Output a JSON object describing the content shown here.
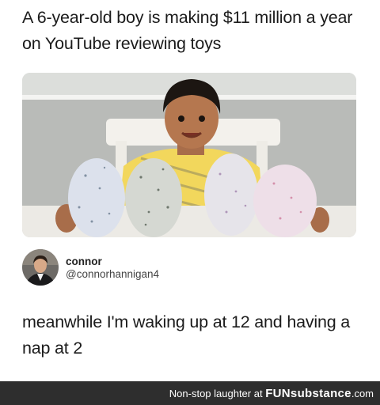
{
  "post": {
    "headline": "A 6-year-old boy is making $11 million a year on YouTube reviewing toys",
    "author_name": "connor",
    "author_handle": "@connorhannigan4",
    "body": "meanwhile I'm waking up at 12 and having a nap at 2"
  },
  "footer": {
    "prefix": "Non-stop laughter at",
    "brand_bold": "FUNsubstance",
    "brand_suffix": ".com"
  },
  "colors": {
    "footer_bg": "#2e2e2e",
    "text": "#1b1b1b",
    "shirt": "#f2d75c"
  }
}
